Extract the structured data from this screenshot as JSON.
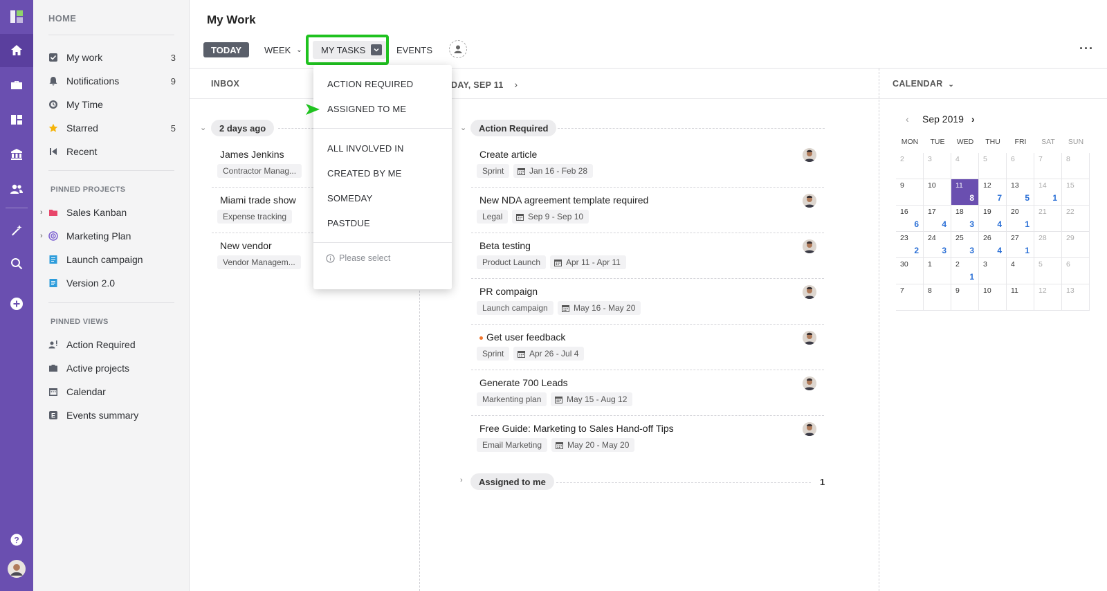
{
  "page": {
    "title": "My Work"
  },
  "sidebar": {
    "home_label": "HOME",
    "items": [
      {
        "label": "My work",
        "count": "3",
        "icon": "checkbox-icon"
      },
      {
        "label": "Notifications",
        "count": "9",
        "icon": "bell-icon"
      },
      {
        "label": "My Time",
        "count": "",
        "icon": "clock-icon"
      },
      {
        "label": "Starred",
        "count": "5",
        "icon": "star-icon"
      },
      {
        "label": "Recent",
        "count": "",
        "icon": "recent-icon"
      }
    ],
    "pinned_projects_label": "PINNED PROJECTS",
    "projects": [
      {
        "label": "Sales Kanban",
        "icon": "folder-icon"
      },
      {
        "label": "Marketing Plan",
        "icon": "target-icon"
      },
      {
        "label": "Launch campaign",
        "icon": "doc-icon"
      },
      {
        "label": "Version 2.0",
        "icon": "doc-icon"
      }
    ],
    "pinned_views_label": "PINNED VIEWS",
    "views": [
      {
        "label": "Action Required",
        "icon": "person-alert-icon"
      },
      {
        "label": "Active projects",
        "icon": "briefcase-icon"
      },
      {
        "label": "Calendar",
        "icon": "calendar-icon"
      },
      {
        "label": "Events summary",
        "icon": "events-icon"
      }
    ]
  },
  "toolbar": {
    "today": "TODAY",
    "week": "WEEK",
    "my_tasks": "MY TASKS",
    "events": "EVENTS",
    "more": "···"
  },
  "dropdown": {
    "items": [
      "ACTION REQUIRED",
      "ASSIGNED TO ME",
      "ALL INVOLVED IN",
      "CREATED BY ME",
      "SOMEDAY",
      "PASTDUE"
    ],
    "hint": "Please select"
  },
  "inbox": {
    "header": "INBOX",
    "group": "2 days ago",
    "items": [
      {
        "title": "James Jenkins",
        "tag": "Contractor Manag..."
      },
      {
        "title": "Miami trade show",
        "tag": "Expense tracking"
      },
      {
        "title": "New vendor",
        "tag": "Vendor Managem..."
      }
    ]
  },
  "tasks": {
    "header": "DAY, SEP 11",
    "group": "Action Required",
    "items": [
      {
        "title": "Create article",
        "tag": "Sprint",
        "dates": "Jan 16 - Feb 28"
      },
      {
        "title": "New NDA agreement template required",
        "tag": "Legal",
        "dates": "Sep 9 - Sep 10"
      },
      {
        "title": "Beta testing",
        "tag": "Product Launch",
        "dates": "Apr 11 - Apr 11"
      },
      {
        "title": "PR compaign",
        "tag": "Launch campaign",
        "dates": "May 16 - May 20"
      },
      {
        "title": "Get user feedback",
        "tag": "Sprint",
        "dates": "Apr 26 - Jul 4"
      },
      {
        "title": "Generate 700 Leads",
        "tag": "Markenting plan",
        "dates": "May 15 - Aug 12"
      },
      {
        "title": "Free Guide: Marketing to Sales Hand-off Tips",
        "tag": "Email Marketing",
        "dates": "May 20 - May 20"
      }
    ],
    "assigned_group": "Assigned to me",
    "assigned_count": "1"
  },
  "calendar": {
    "header": "CALENDAR",
    "month": "Sep 2019",
    "dow": [
      "MON",
      "TUE",
      "WED",
      "THU",
      "FRI",
      "SAT",
      "SUN"
    ],
    "weeks": [
      [
        {
          "d": "2"
        },
        {
          "d": "3"
        },
        {
          "d": "4"
        },
        {
          "d": "5"
        },
        {
          "d": "6"
        },
        {
          "d": "7"
        },
        {
          "d": "8"
        }
      ],
      [
        {
          "d": "9"
        },
        {
          "d": "10"
        },
        {
          "d": "11",
          "c": "8",
          "sel": true
        },
        {
          "d": "12",
          "c": "7"
        },
        {
          "d": "13",
          "c": "5"
        },
        {
          "d": "14",
          "c": "1"
        },
        {
          "d": "15"
        }
      ],
      [
        {
          "d": "16",
          "c": "6"
        },
        {
          "d": "17",
          "c": "4"
        },
        {
          "d": "18",
          "c": "3"
        },
        {
          "d": "19",
          "c": "4"
        },
        {
          "d": "20",
          "c": "1"
        },
        {
          "d": "21"
        },
        {
          "d": "22"
        }
      ],
      [
        {
          "d": "23",
          "c": "2"
        },
        {
          "d": "24",
          "c": "3"
        },
        {
          "d": "25",
          "c": "3"
        },
        {
          "d": "26",
          "c": "4"
        },
        {
          "d": "27",
          "c": "1"
        },
        {
          "d": "28"
        },
        {
          "d": "29"
        }
      ],
      [
        {
          "d": "30"
        },
        {
          "d": "1"
        },
        {
          "d": "2",
          "c": "1"
        },
        {
          "d": "3"
        },
        {
          "d": "4"
        },
        {
          "d": "5"
        },
        {
          "d": "6"
        }
      ],
      [
        {
          "d": "7"
        },
        {
          "d": "8"
        },
        {
          "d": "9"
        },
        {
          "d": "10"
        },
        {
          "d": "11"
        },
        {
          "d": "12"
        },
        {
          "d": "13"
        }
      ]
    ]
  },
  "colors": {
    "brand": "#6a4fb0",
    "highlight": "#1fc21f",
    "count": "#2a6fd6"
  }
}
